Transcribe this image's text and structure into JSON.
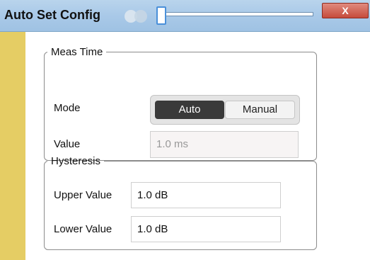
{
  "window": {
    "title": "Auto Set Config",
    "close_label": "X",
    "colors": {
      "title_bar": "#a9c9e8",
      "close_button": "#c64b3b",
      "side_strip": "#e5cd64"
    }
  },
  "meas_time": {
    "legend": "Meas Time",
    "mode_label": "Mode",
    "mode_options": [
      "Auto",
      "Manual"
    ],
    "mode_selected": "Auto",
    "value_label": "Value",
    "value": "1.0 ms"
  },
  "hysteresis": {
    "legend": "Hysteresis",
    "upper_label": "Upper Value",
    "upper_value": "1.0 dB",
    "lower_label": "Lower Value",
    "lower_value": "1.0 dB"
  }
}
